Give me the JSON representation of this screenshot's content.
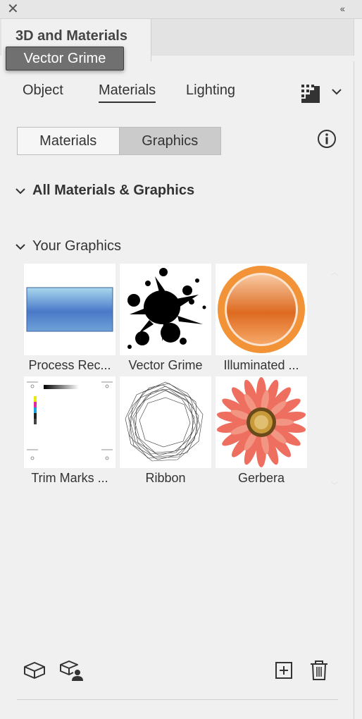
{
  "window": {
    "close_glyph": "✕",
    "collapse_glyph": "‹‹"
  },
  "panel": {
    "title": "3D and Materials",
    "tooltip": "Vector Grime"
  },
  "tabs": [
    {
      "label": "Object",
      "active": false
    },
    {
      "label": "Materials",
      "active": true
    },
    {
      "label": "Lighting",
      "active": false
    }
  ],
  "segment": {
    "materials_label": "Materials",
    "graphics_label": "Graphics",
    "selected": "Graphics"
  },
  "sections": {
    "all": "All Materials & Graphics",
    "yours": "Your Graphics"
  },
  "graphics": [
    {
      "name": "Process Rec...",
      "thumb": "gradient-rectangle"
    },
    {
      "name": "Vector Grime",
      "thumb": "ink-splatter"
    },
    {
      "name": "Illuminated ...",
      "thumb": "orange-button"
    },
    {
      "name": "Trim Marks ...",
      "thumb": "trim-marks"
    },
    {
      "name": "Ribbon",
      "thumb": "ribbon-ring"
    },
    {
      "name": "Gerbera",
      "thumb": "gerbera-flower"
    }
  ],
  "icons": {
    "options": "options-grid-icon",
    "menu": "chevron-down-icon",
    "info": "info-icon",
    "add_material": "cube-icon",
    "add_user": "cube-user-icon",
    "new": "add-square-icon",
    "delete": "trash-icon"
  }
}
